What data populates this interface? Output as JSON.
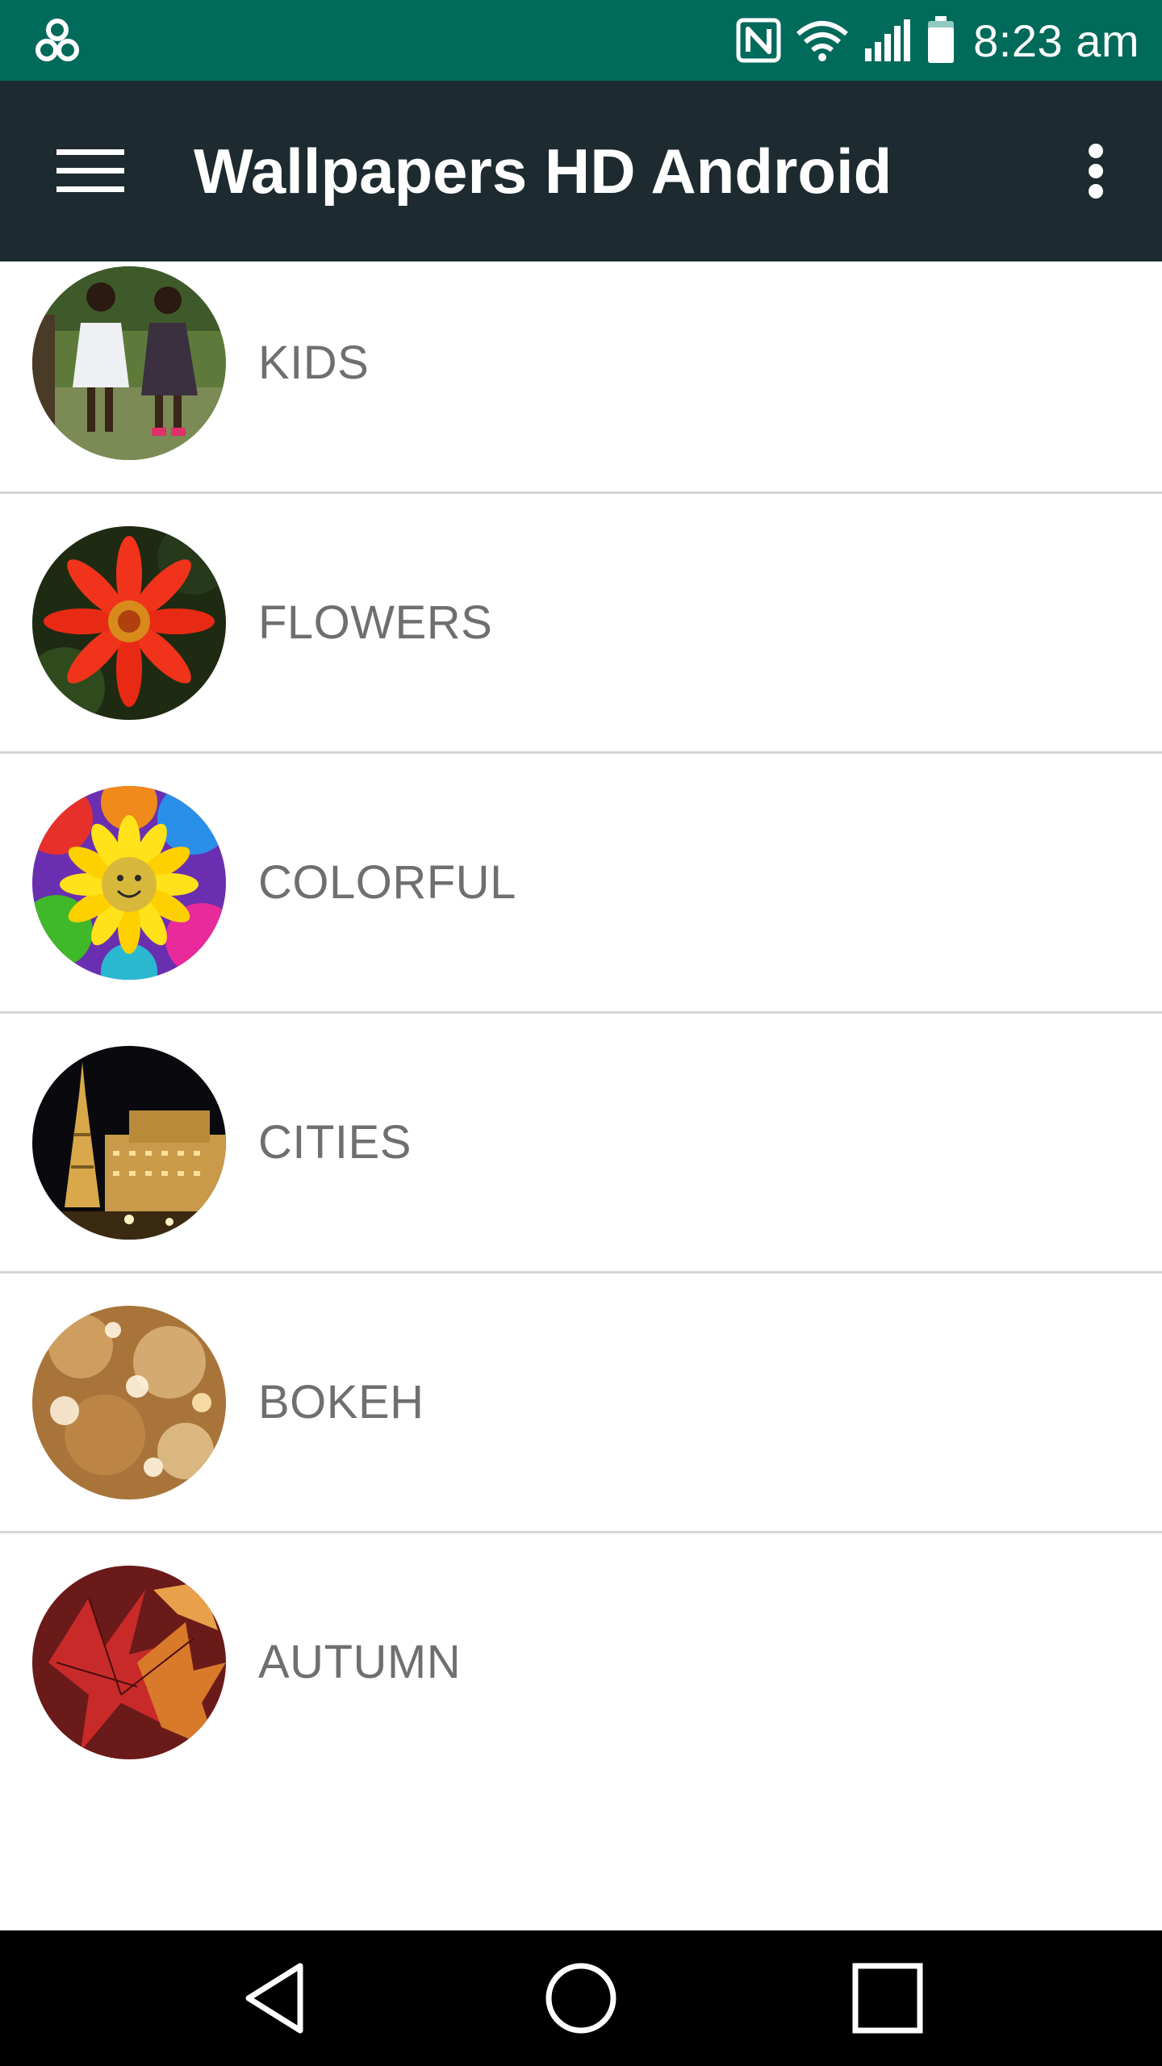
{
  "status_bar": {
    "time": "8:23 am",
    "icons": [
      "app-notification-icon",
      "nfc-icon",
      "wifi-icon",
      "cell-signal-icon",
      "battery-icon"
    ]
  },
  "app_bar": {
    "title": "Wallpapers HD Android",
    "menu_icon": "hamburger-menu-icon",
    "overflow_icon": "more-vert-icon"
  },
  "categories": [
    {
      "label": "KIDS"
    },
    {
      "label": "FLOWERS"
    },
    {
      "label": "COLORFUL"
    },
    {
      "label": "CITIES"
    },
    {
      "label": "BOKEH"
    },
    {
      "label": "AUTUMN"
    }
  ],
  "nav_bar": {
    "icons": [
      "back-icon",
      "home-icon",
      "recents-icon"
    ]
  },
  "colors": {
    "status_bar": "#006a5b",
    "app_bar": "#1d2a30",
    "label_text": "#6f6f6f",
    "divider": "#d6d6d6",
    "nav_bar": "#000000"
  }
}
